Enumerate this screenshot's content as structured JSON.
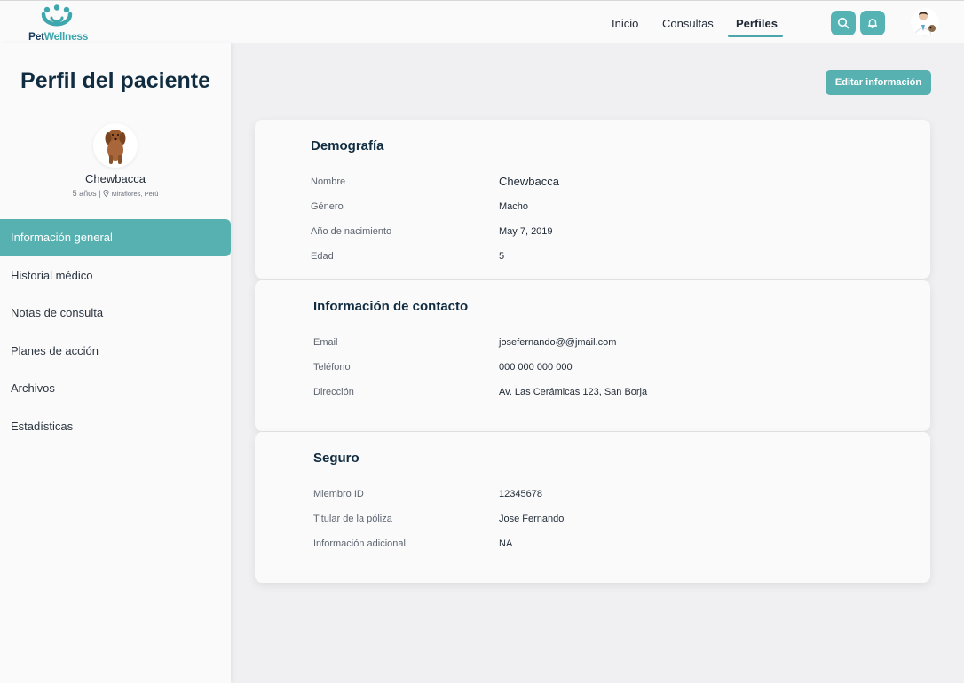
{
  "brand": {
    "name_part1": "Pet",
    "name_part2": "Wellness"
  },
  "nav": {
    "items": [
      {
        "label": "Inicio"
      },
      {
        "label": "Consultas"
      },
      {
        "label": "Perfiles",
        "active": true
      }
    ]
  },
  "icons": {
    "search": "search-icon",
    "notifications": "bell-icon",
    "user": "doctor-avatar"
  },
  "colors": {
    "accent": "#58b1b1",
    "title": "#102c40",
    "brand_dark": "#173a5e",
    "brand_teal": "#3ea6ad"
  },
  "sidebar": {
    "title": "Perfil del paciente",
    "pet": {
      "name": "Chewbacca",
      "age": "5 años",
      "location": "Miraflores, Perú"
    },
    "menu": [
      {
        "label": "Información general",
        "active": true
      },
      {
        "label": "Historial médico"
      },
      {
        "label": "Notas de consulta"
      },
      {
        "label": "Planes de acción"
      },
      {
        "label": "Archivos"
      },
      {
        "label": "Estadísticas"
      }
    ]
  },
  "main": {
    "edit_button": "Editar información",
    "cards": [
      {
        "title": "Demografía",
        "rows": [
          {
            "label": "Nombre",
            "value": "Chewbacca"
          },
          {
            "label": "Género",
            "value": "Macho"
          },
          {
            "label": "Año de nacimiento",
            "value": "May 7, 2019"
          },
          {
            "label": "Edad",
            "value": "5"
          }
        ]
      },
      {
        "title": "Información de contacto",
        "rows": [
          {
            "label": "Email",
            "value": "josefernando@@jmail.com"
          },
          {
            "label": "Teléfono",
            "value": "000 000 000 000"
          },
          {
            "label": "Dirección",
            "value": "Av. Las Cerámicas 123, San Borja"
          }
        ]
      },
      {
        "title": "Seguro",
        "rows": [
          {
            "label": "Miembro ID",
            "value": "12345678"
          },
          {
            "label": "Titular de la póliza",
            "value": "Jose Fernando"
          },
          {
            "label": "Información adicional",
            "value": "NA"
          }
        ]
      }
    ]
  }
}
